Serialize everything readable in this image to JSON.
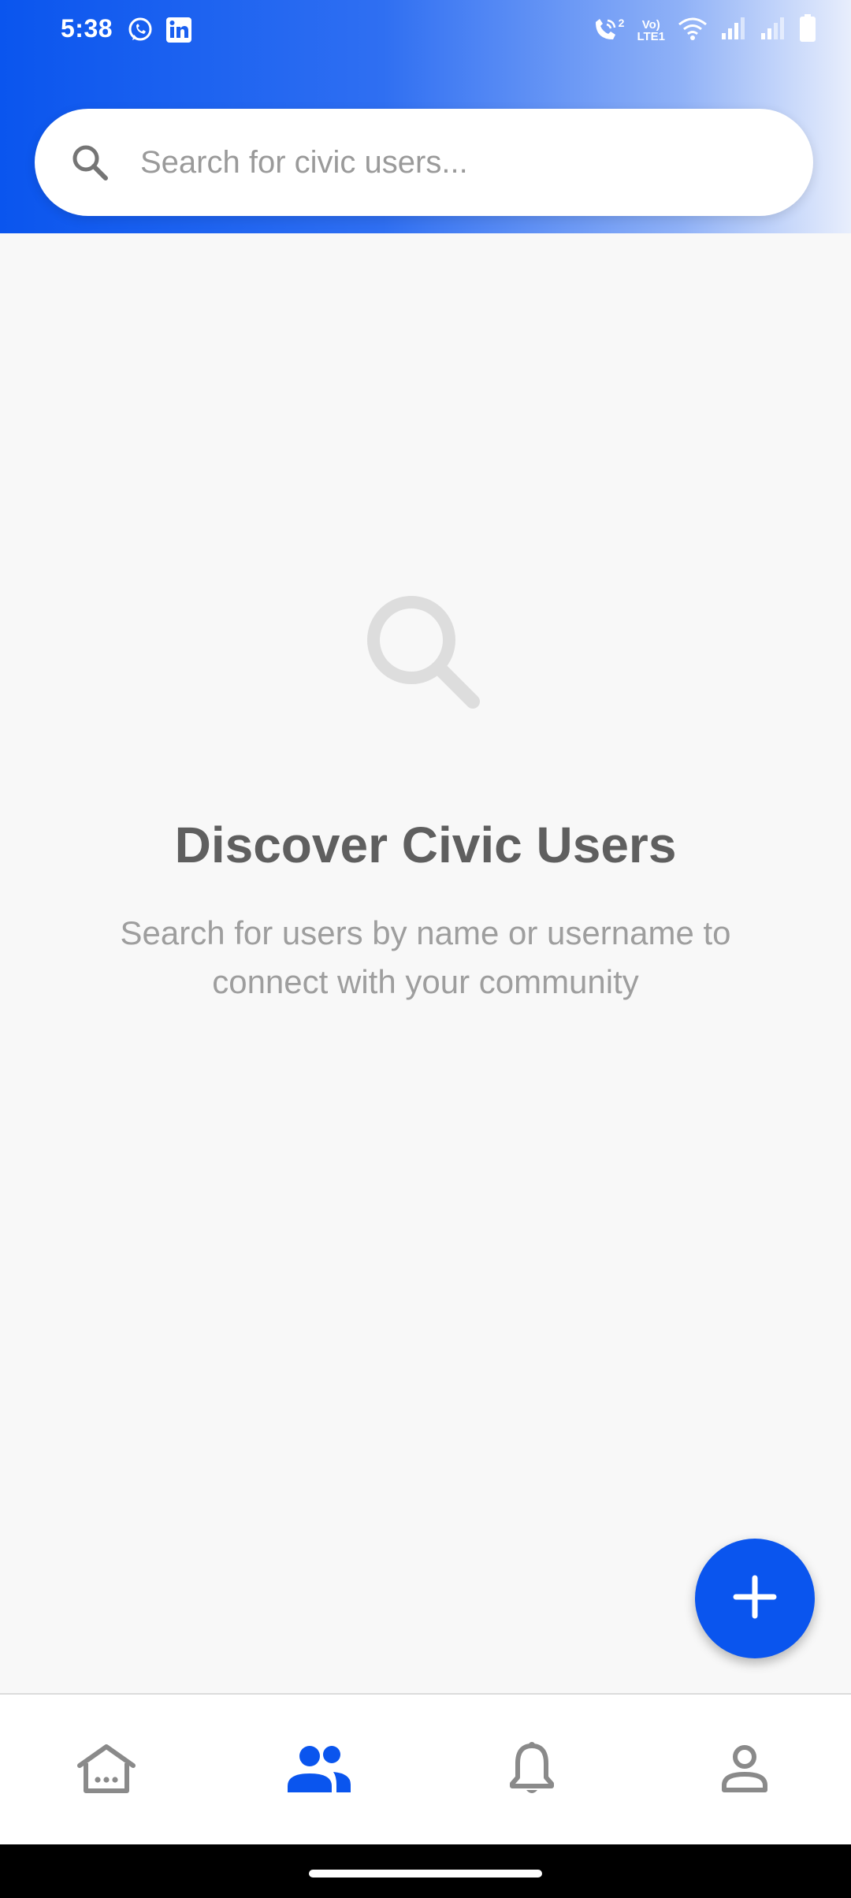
{
  "status_bar": {
    "time": "5:38",
    "left_icons": [
      "whatsapp-icon",
      "linkedin-icon"
    ],
    "volte_line1": "Vo)",
    "volte_line2": "LTE1",
    "call_sim": "2",
    "right_icons": [
      "wifi-calling-icon",
      "volte-icon",
      "wifi-icon",
      "signal-icon",
      "signal-icon",
      "battery-icon"
    ]
  },
  "search": {
    "placeholder": "Search for civic users...",
    "value": "",
    "icon": "search-icon"
  },
  "empty_state": {
    "icon": "search-icon",
    "title": "Discover Civic Users",
    "subtitle": "Search for users by name or username to connect with your community"
  },
  "fab": {
    "icon": "plus-icon"
  },
  "bottom_nav": {
    "items": [
      {
        "icon": "home-icon",
        "active": false
      },
      {
        "icon": "people-icon",
        "active": true
      },
      {
        "icon": "bell-icon",
        "active": false
      },
      {
        "icon": "person-icon",
        "active": false
      }
    ]
  },
  "colors": {
    "brand": "#0A55EE",
    "background": "#F8F8F8",
    "inactive_icon": "#8A8A8A",
    "empty_icon": "#DDDDDD",
    "title": "#5F5F5F",
    "subtitle": "#9E9E9E"
  }
}
